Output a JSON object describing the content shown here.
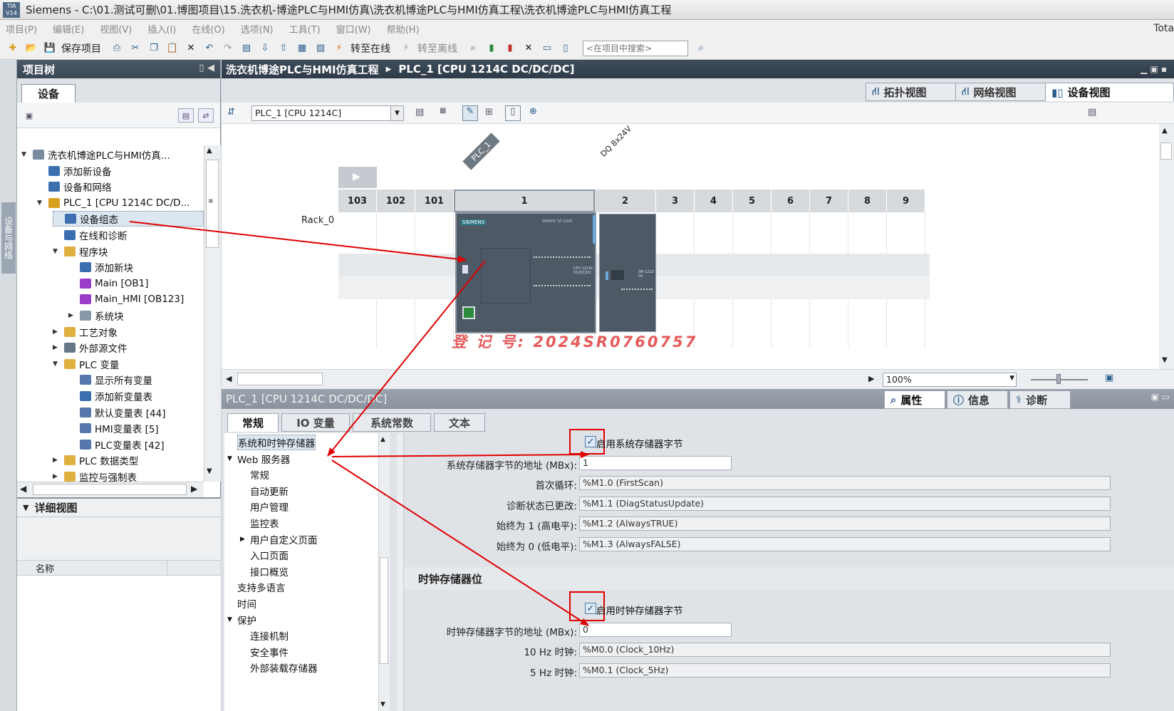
{
  "titlebar": {
    "logo": "TIA V14",
    "title": "Siemens  -  C:\\01.测试可删\\01.博图项目\\15.洗衣机-博途PLC与HMI仿真\\洗衣机博途PLC与HMI仿真工程\\洗衣机博途PLC与HMI仿真工程"
  },
  "menu": [
    "项目(P)",
    "编辑(E)",
    "视图(V)",
    "插入(I)",
    "在线(O)",
    "选项(N)",
    "工具(T)",
    "窗口(W)",
    "帮助(H)"
  ],
  "menu_right": "Tota",
  "toolbar": {
    "save_project": "保存项目",
    "go_online": "转至在线",
    "go_offline": "转至离线",
    "search_placeholder": "<在项目中搜索>"
  },
  "left_vtab": "设备与网络",
  "project_tree": {
    "title": "项目树",
    "tab": "设备",
    "items": [
      {
        "label": "洗衣机博途PLC与HMI仿真...",
        "level": 0,
        "twisty": "▼",
        "icon": "project-icon"
      },
      {
        "label": "添加新设备",
        "level": 1,
        "twisty": "",
        "icon": "add-device-icon"
      },
      {
        "label": "设备和网络",
        "level": 1,
        "twisty": "",
        "icon": "network-icon"
      },
      {
        "label": "PLC_1 [CPU 1214C DC/D...",
        "level": 1,
        "twisty": "▼",
        "icon": "plc-folder-icon"
      },
      {
        "label": "设备组态",
        "level": 2,
        "twisty": "",
        "icon": "device-config-icon",
        "selected": true
      },
      {
        "label": "在线和诊断",
        "level": 2,
        "twisty": "",
        "icon": "diagnostics-icon"
      },
      {
        "label": "程序块",
        "level": 2,
        "twisty": "▼",
        "icon": "folder-icon"
      },
      {
        "label": "添加新块",
        "level": 3,
        "twisty": "",
        "icon": "add-block-icon"
      },
      {
        "label": "Main [OB1]",
        "level": 3,
        "twisty": "",
        "icon": "ob-block-icon"
      },
      {
        "label": "Main_HMI [OB123]",
        "level": 3,
        "twisty": "",
        "icon": "ob-block-icon"
      },
      {
        "label": "系统块",
        "level": 3,
        "twisty": "▶",
        "icon": "system-block-icon"
      },
      {
        "label": "工艺对象",
        "level": 2,
        "twisty": "▶",
        "icon": "folder-icon"
      },
      {
        "label": "外部源文件",
        "level": 2,
        "twisty": "▶",
        "icon": "source-file-icon"
      },
      {
        "label": "PLC 变量",
        "level": 2,
        "twisty": "▼",
        "icon": "folder-icon"
      },
      {
        "label": "显示所有变量",
        "level": 3,
        "twisty": "",
        "icon": "tag-table-icon"
      },
      {
        "label": "添加新变量表",
        "level": 3,
        "twisty": "",
        "icon": "add-tag-table-icon"
      },
      {
        "label": "默认变量表 [44]",
        "level": 3,
        "twisty": "",
        "icon": "tag-table-icon"
      },
      {
        "label": "HMI变量表 [5]",
        "level": 3,
        "twisty": "",
        "icon": "tag-table-icon"
      },
      {
        "label": "PLC变量表 [42]",
        "level": 3,
        "twisty": "",
        "icon": "tag-table-icon"
      },
      {
        "label": "PLC 数据类型",
        "level": 2,
        "twisty": "▶",
        "icon": "folder-icon"
      },
      {
        "label": "监控与强制表",
        "level": 2,
        "twisty": "▶",
        "icon": "folder-icon"
      }
    ],
    "detail_view": {
      "title": "详细视图",
      "column": "名称"
    }
  },
  "editor": {
    "breadcrumb": [
      "洗衣机博途PLC与HMI仿真工程",
      "PLC_1 [CPU 1214C DC/DC/DC]"
    ],
    "view_tabs": [
      "拓扑视图",
      "网络视图",
      "设备视图"
    ],
    "device_select": "PLC_1 [CPU 1214C]",
    "rack_label": "Rack_0",
    "slots": [
      "103",
      "102",
      "101",
      "1",
      "2",
      "3",
      "4",
      "5",
      "6",
      "7",
      "8",
      "9"
    ],
    "module_labels": [
      "PLC_1",
      "DQ 8x24V"
    ],
    "cpu_brand": "SIEMENS",
    "cpu_model_small": "SIMATIC S7-1200",
    "cpu_type_small": "CPU 1214C\nDC/DC/DC",
    "sm_small": "SM 1222\nDC",
    "zoom": "100%",
    "watermark": "登 记 号:  2024SR0760757"
  },
  "inspector": {
    "title": "PLC_1 [CPU 1214C DC/DC/DC]",
    "right_tabs": [
      "属性",
      "信息",
      "诊断"
    ],
    "tabs": [
      "常规",
      "IO 变量",
      "系统常数",
      "文本"
    ],
    "nav": [
      {
        "label": "系统和时钟存储器",
        "level": 0,
        "twisty": "",
        "selected": true
      },
      {
        "label": "Web 服务器",
        "level": 0,
        "twisty": "▼"
      },
      {
        "label": "常规",
        "level": 1,
        "twisty": ""
      },
      {
        "label": "自动更新",
        "level": 1,
        "twisty": ""
      },
      {
        "label": "用户管理",
        "level": 1,
        "twisty": ""
      },
      {
        "label": "监控表",
        "level": 1,
        "twisty": ""
      },
      {
        "label": "用户自定义页面",
        "level": 1,
        "twisty": "▶"
      },
      {
        "label": "入口页面",
        "level": 1,
        "twisty": ""
      },
      {
        "label": "接口概览",
        "level": 1,
        "twisty": ""
      },
      {
        "label": "支持多语言",
        "level": 0,
        "twisty": ""
      },
      {
        "label": "时间",
        "level": 0,
        "twisty": ""
      },
      {
        "label": "保护",
        "level": 0,
        "twisty": "▼"
      },
      {
        "label": "连接机制",
        "level": 1,
        "twisty": ""
      },
      {
        "label": "安全事件",
        "level": 1,
        "twisty": ""
      },
      {
        "label": "外部装载存储器",
        "level": 1,
        "twisty": ""
      }
    ],
    "system_memory": {
      "enable_label": "启用系统存储器字节",
      "enabled": true,
      "address_label": "系统存储器字节的地址 (MBx):",
      "address_value": "1",
      "rows": [
        {
          "label": "首次循环:",
          "value": "%M1.0 (FirstScan)"
        },
        {
          "label": "诊断状态已更改:",
          "value": "%M1.1 (DiagStatusUpdate)"
        },
        {
          "label": "始终为 1 (高电平):",
          "value": "%M1.2 (AlwaysTRUE)"
        },
        {
          "label": "始终为 0 (低电平):",
          "value": "%M1.3 (AlwaysFALSE)"
        }
      ]
    },
    "clock_memory": {
      "section_title": "时钟存储器位",
      "enable_label": "启用时钟存储器字节",
      "enabled": true,
      "address_label": "时钟存储器字节的地址 (MBx):",
      "address_value": "0",
      "rows": [
        {
          "label": "10 Hz 时钟:",
          "value": "%M0.0 (Clock_10Hz)"
        },
        {
          "label": "5 Hz 时钟:",
          "value": "%M0.1 (Clock_5Hz)"
        }
      ]
    }
  },
  "colors": {
    "annotation_red": "#e00000",
    "panel_header_dark": "#3a4754",
    "checkbox_blue": "#4a7aa6",
    "selection": "#dbe6f1"
  }
}
